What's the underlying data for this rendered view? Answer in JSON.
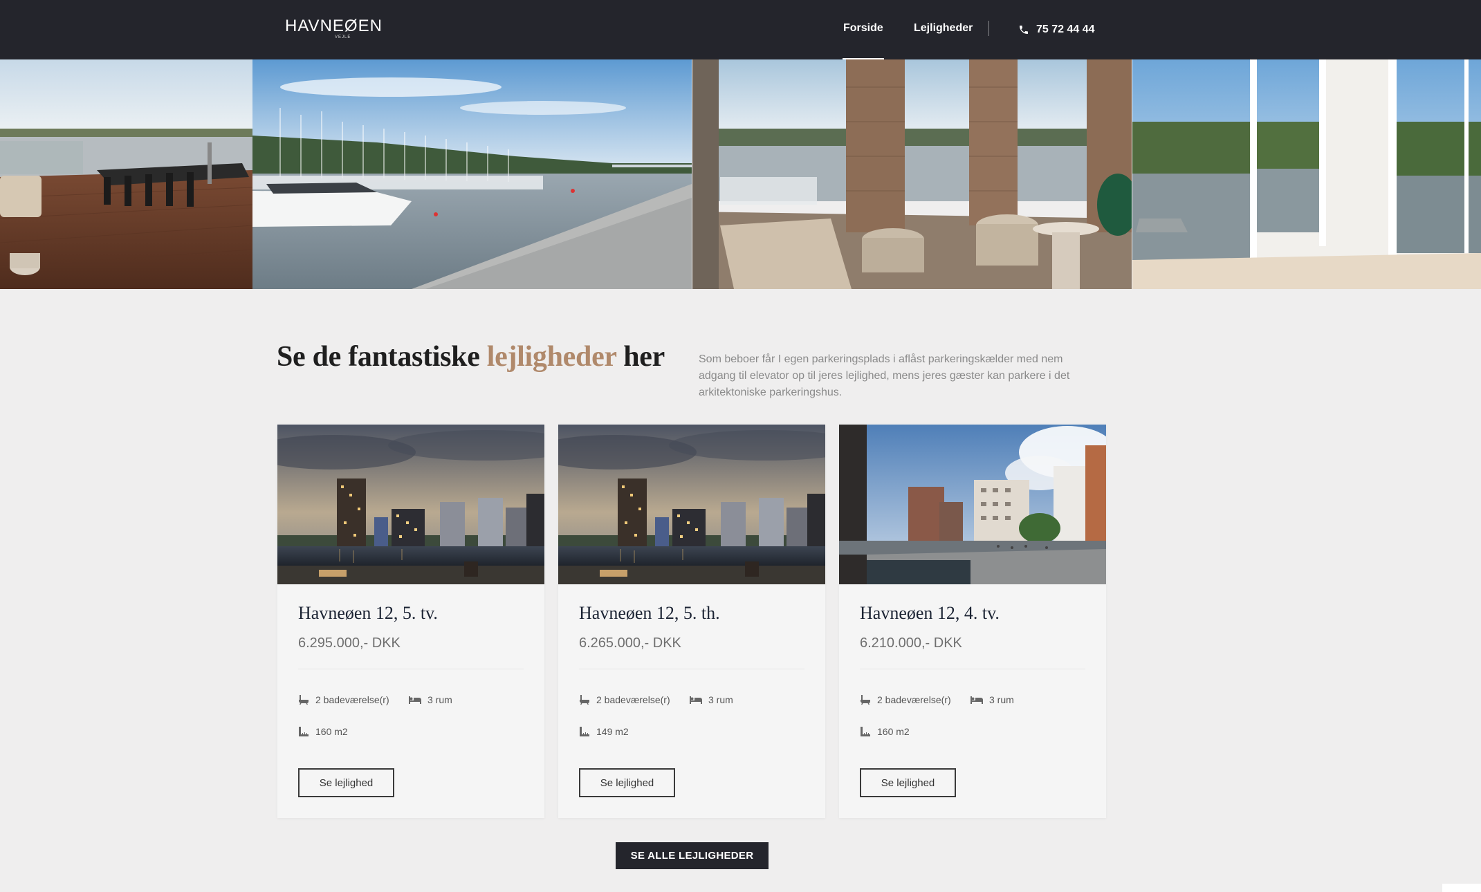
{
  "header": {
    "logo_text": "HAVNEØEN",
    "logo_subtext": "VEJLE",
    "nav": [
      {
        "label": "Forside",
        "active": true
      },
      {
        "label": "Lejligheder",
        "active": false
      }
    ],
    "phone": "75 72 44 44",
    "phone_icon": "phone-icon",
    "background_color": "#24252c"
  },
  "hero": {
    "images": [
      "rooftop-terrace-photo",
      "marina-harbor-photo",
      "balcony-lounge-photo",
      "window-view-photo"
    ]
  },
  "intro": {
    "title_before": "Se de fantastiske ",
    "title_accent": "lejligheder",
    "title_after": " her",
    "accent_color": "#b0896b",
    "text": "Som beboer får I egen parkeringsplads i aflåst parkeringskælder med nem adgang til elevator op til jeres lejlighed, mens jeres gæster kan parkere i det arkitektoniske parkeringshus."
  },
  "listings": [
    {
      "title": "Havneøen 12, 5. tv.",
      "price": "6.295.000,- DKK",
      "bathrooms": "2 badeværelse(r)",
      "rooms": "3 rum",
      "area": "160 m2",
      "button": "Se lejlighed",
      "image": "evening-towers-render"
    },
    {
      "title": "Havneøen 12, 5. th.",
      "price": "6.265.000,- DKK",
      "bathrooms": "2 badeværelse(r)",
      "rooms": "3 rum",
      "area": "149 m2",
      "button": "Se lejlighed",
      "image": "evening-towers-render"
    },
    {
      "title": "Havneøen 12, 4. tv.",
      "price": "6.210.000,- DKK",
      "bathrooms": "2 badeværelse(r)",
      "rooms": "3 rum",
      "area": "160 m2",
      "button": "Se lejlighed",
      "image": "daytime-harbor-render"
    }
  ],
  "icons": {
    "bath": "bathtub-icon",
    "rooms": "bed-icon",
    "area": "ruler-icon"
  },
  "all_button": "SE ALLE LEJLIGHEDER"
}
